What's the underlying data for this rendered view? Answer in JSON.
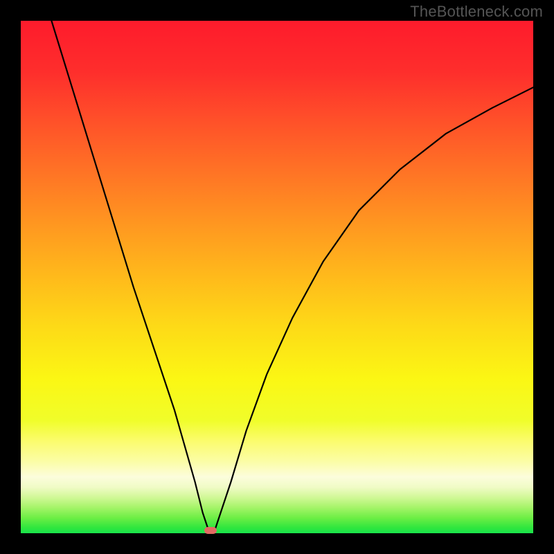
{
  "watermark": "TheBottleneck.com",
  "chart_data": {
    "type": "line",
    "title": "",
    "xlabel": "",
    "ylabel": "",
    "xlim": [
      0,
      100
    ],
    "ylim": [
      0,
      100
    ],
    "background": "rainbow-gradient-red-to-green",
    "series": [
      {
        "name": "bottleneck-curve",
        "x": [
          6,
          10,
          14,
          18,
          22,
          26,
          30,
          32,
          34,
          35.5,
          36.5,
          37.2,
          38,
          39,
          41,
          44,
          48,
          53,
          59,
          66,
          74,
          83,
          92,
          100
        ],
        "values": [
          100,
          87,
          74,
          61,
          48,
          36,
          24,
          17,
          10,
          4,
          1,
          0.5,
          1,
          4,
          10,
          20,
          31,
          42,
          53,
          63,
          71,
          78,
          83,
          87
        ]
      }
    ],
    "marker": {
      "x": 37,
      "y": 0.5,
      "color": "#e26a62"
    },
    "grid": false,
    "legend": false
  }
}
